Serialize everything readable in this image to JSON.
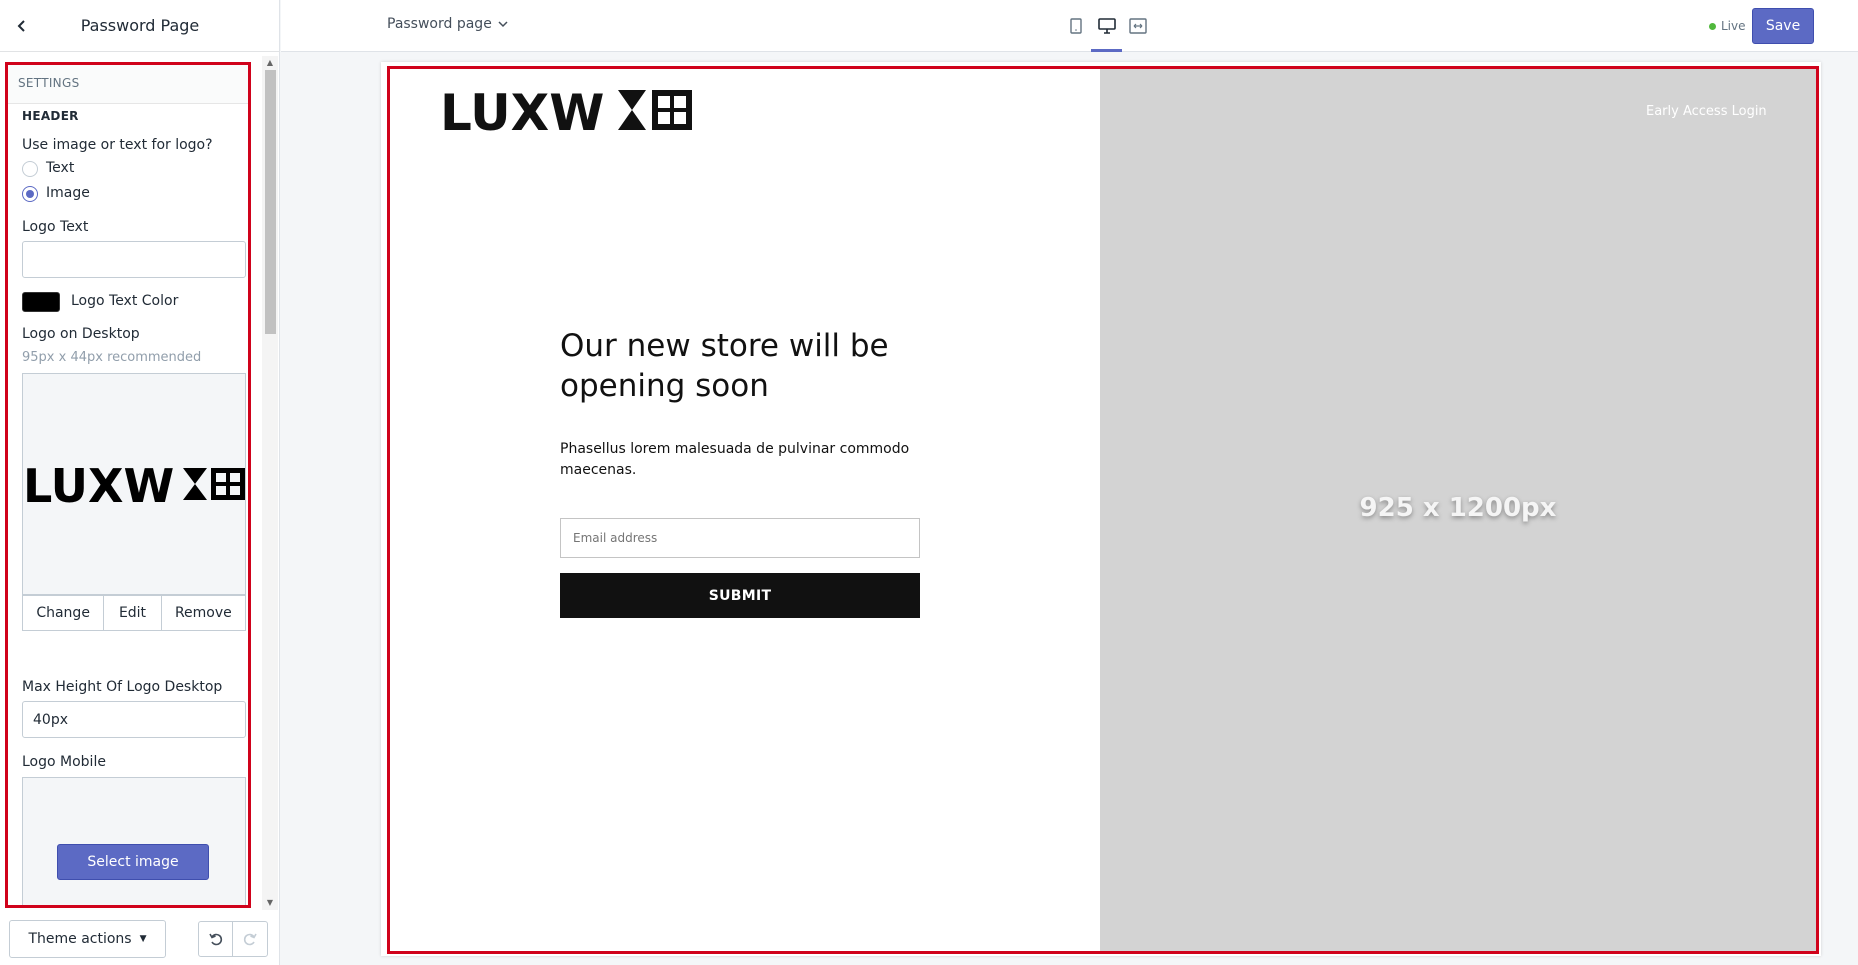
{
  "sidebar": {
    "title": "Password Page",
    "section_label": "SETTINGS",
    "header_heading": "HEADER",
    "logo_type_question": "Use image or text for logo?",
    "logo_type_options": [
      "Text",
      "Image"
    ],
    "logo_type_selected": "Image",
    "logo_text_label": "Logo Text",
    "logo_text_value": "",
    "logo_text_color_label": "Logo Text Color",
    "logo_text_color": "#000000",
    "logo_desktop_label": "Logo on Desktop",
    "logo_desktop_hint": "95px x 44px recommended",
    "logo_desktop_image": "LUXW",
    "image_actions": [
      "Change",
      "Edit",
      "Remove"
    ],
    "max_height_label": "Max Height Of Logo Desktop",
    "max_height_value": "40px",
    "logo_mobile_label": "Logo Mobile",
    "select_image_label": "Select image",
    "theme_actions_label": "Theme actions"
  },
  "topbar": {
    "page_select": "Password page",
    "device_icons": [
      "mobile-icon",
      "desktop-icon",
      "fullscreen-icon"
    ],
    "active_device": "desktop-icon",
    "live_label": "Live",
    "save_label": "Save"
  },
  "preview": {
    "brand_logo": "LUXW",
    "early_access": "Early Access Login",
    "headline": "Our new store will be opening soon",
    "subtext": "Phasellus lorem malesuada de pulvinar commodo maecenas.",
    "email_placeholder": "Email address",
    "submit_label": "SUBMIT",
    "image_placeholder": "925 x 1200px"
  },
  "colors": {
    "accent": "#5c6ac4",
    "highlight_border": "#d0021b",
    "live": "#50b83c",
    "placeholder_bg": "#d3d3d3"
  }
}
